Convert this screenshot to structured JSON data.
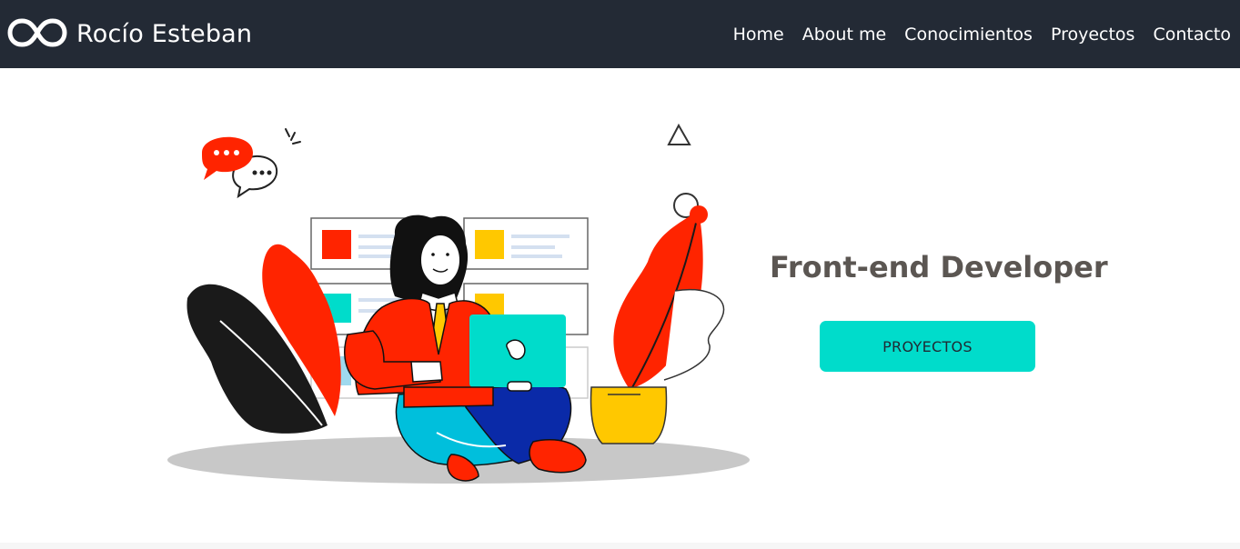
{
  "brand": {
    "name": "Rocío Esteban",
    "logo_icon": "infinity-icon"
  },
  "nav": {
    "items": [
      {
        "label": "Home"
      },
      {
        "label": "About me"
      },
      {
        "label": "Conocimientos"
      },
      {
        "label": "Proyectos"
      },
      {
        "label": "Contacto"
      }
    ]
  },
  "hero": {
    "title": "Front-end Developer",
    "cta_label": "PROYECTOS",
    "illustration": "woman-with-laptop-illustration"
  },
  "colors": {
    "navbar_bg": "#232a35",
    "accent": "#00dccb",
    "title": "#5b5652",
    "illustration_red": "#ff2400",
    "illustration_yellow": "#ffc800",
    "illustration_blue": "#0a2aa8"
  }
}
